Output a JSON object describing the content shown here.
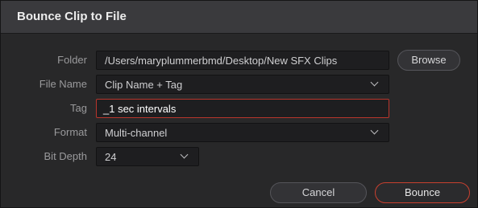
{
  "dialog": {
    "title": "Bounce Clip to File"
  },
  "form": {
    "folder": {
      "label": "Folder",
      "value": "/Users/maryplummerbmd/Desktop/New SFX Clips",
      "browse_label": "Browse"
    },
    "file_name": {
      "label": "File Name",
      "value": "Clip Name + Tag"
    },
    "tag": {
      "label": "Tag",
      "value": "_1 sec intervals"
    },
    "format": {
      "label": "Format",
      "value": "Multi-channel"
    },
    "bit_depth": {
      "label": "Bit Depth",
      "value": "24"
    }
  },
  "buttons": {
    "cancel_label": "Cancel",
    "bounce_label": "Bounce"
  },
  "colors": {
    "accent": "#c8402f",
    "background": "#282829"
  }
}
